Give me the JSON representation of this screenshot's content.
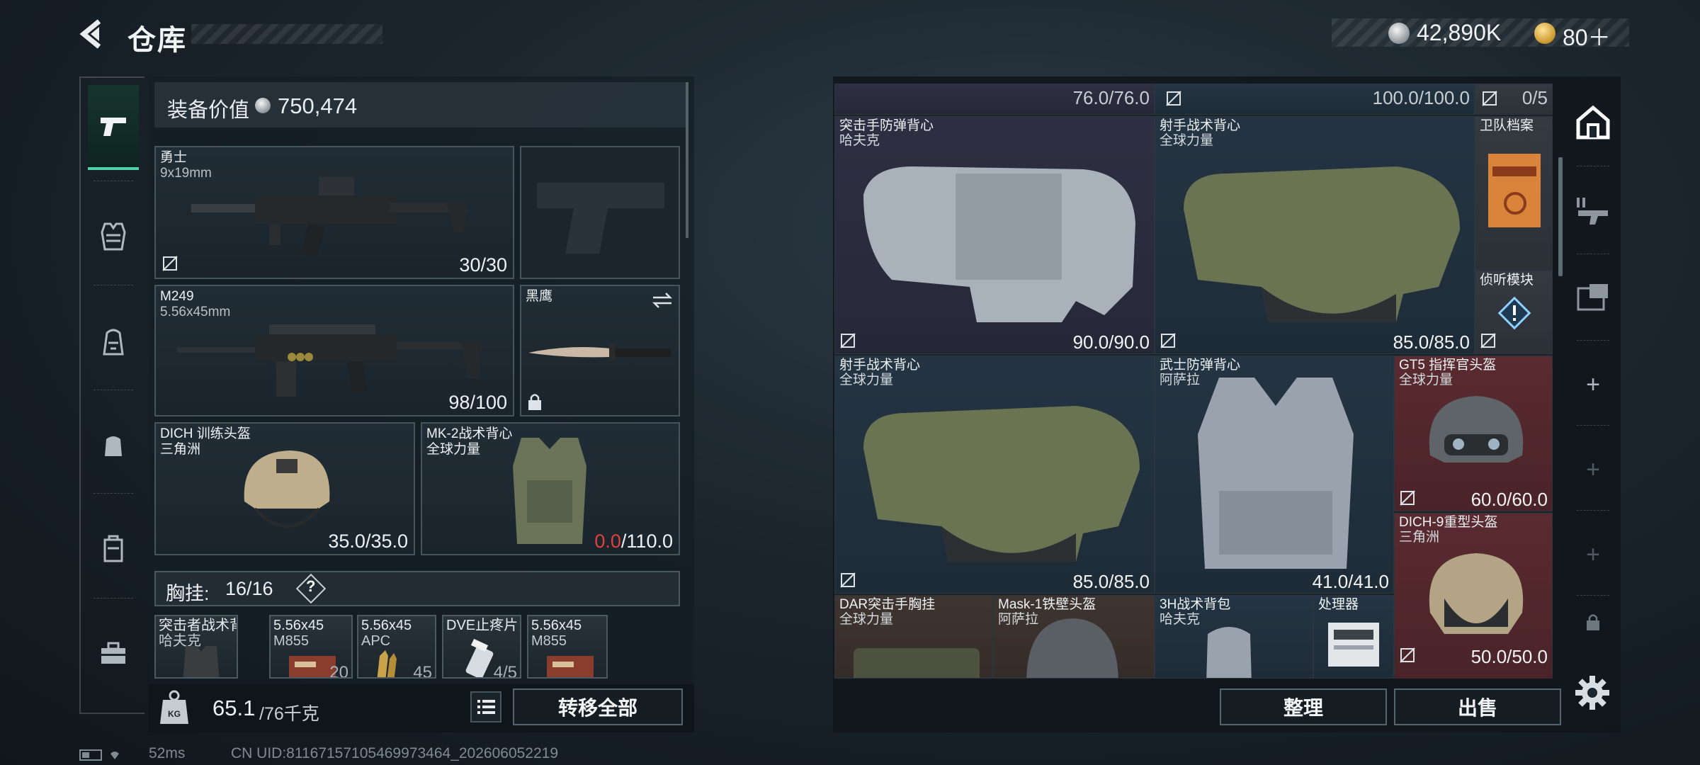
{
  "header": {
    "title": "仓库",
    "currency_silver": "42,890K",
    "currency_gold": "80＋"
  },
  "loadout": {
    "equip_value_label": "装备价值",
    "equip_value": "750,474",
    "primary": {
      "name": "勇士",
      "caliber": "9x19mm",
      "ammo": "30/30"
    },
    "secondary": {
      "name": "M249",
      "caliber": "5.56x45mm",
      "ammo": "98/100"
    },
    "melee": {
      "name": "黑鹰"
    },
    "helmet": {
      "name": "DICH 训练头盔",
      "maker": "三角洲",
      "durability": "35.0/35.0"
    },
    "armor": {
      "name": "MK-2战术背心",
      "maker": "全球力量",
      "durability_current": "0.0",
      "durability_max": "/110.0"
    },
    "chest_rig": {
      "label": "胸挂:",
      "count": "16/16",
      "help": "?"
    },
    "pouches": [
      {
        "name": "突击者战术背心",
        "sub": "哈夫克",
        "count": ""
      },
      {
        "name": "5.56x45",
        "sub": "M855",
        "count": "20"
      },
      {
        "name": "5.56x45",
        "sub": "APC",
        "count": "45"
      },
      {
        "name": "DVE止疼片",
        "sub": "",
        "count": "4/5"
      },
      {
        "name": "5.56x45",
        "sub": "M855",
        "count": ""
      }
    ],
    "weight": "65.1",
    "weight_max": "/76千克",
    "transfer_all": "转移全部"
  },
  "status": {
    "ping": "52ms",
    "uid": "CN UID:81167157105469973464_202606052219"
  },
  "storage": {
    "top_row": [
      "76.0/76.0",
      "100.0/100.0",
      "0/5"
    ],
    "items": [
      {
        "name": "突击手防弹背心",
        "maker": "哈夫克",
        "durability": "90.0/90.0"
      },
      {
        "name": "射手战术背心",
        "maker": "全球力量",
        "durability": "85.0/85.0"
      },
      {
        "name": "卫队档案",
        "maker": "",
        "durability": ""
      },
      {
        "name": "侦听模块",
        "maker": "",
        "durability": ""
      },
      {
        "name": "射手战术背心",
        "maker": "全球力量",
        "durability": "85.0/85.0"
      },
      {
        "name": "武士防弹背心",
        "maker": "阿萨拉",
        "durability": "41.0/41.0"
      },
      {
        "name": "GT5 指挥官头盔",
        "maker": "全球力量",
        "durability": "60.0/60.0"
      },
      {
        "name": "DICH-9重型头盔",
        "maker": "三角洲",
        "durability": "50.0/50.0"
      },
      {
        "name": "DAR突击手胸挂",
        "maker": "全球力量",
        "durability": ""
      },
      {
        "name": "Mask-1铁壁头盔",
        "maker": "阿萨拉",
        "durability": ""
      },
      {
        "name": "3H战术背包",
        "maker": "哈夫克",
        "durability": ""
      },
      {
        "name": "处理器",
        "maker": "",
        "durability": ""
      }
    ],
    "sort": "整理",
    "sell": "出售"
  },
  "right_tabs": [
    "+",
    "+",
    "+"
  ],
  "icons": {
    "back": "back-arrow-icon",
    "settings": "gear-icon",
    "accent": "#4fd3a6",
    "durability_broken": "#e0413b"
  }
}
